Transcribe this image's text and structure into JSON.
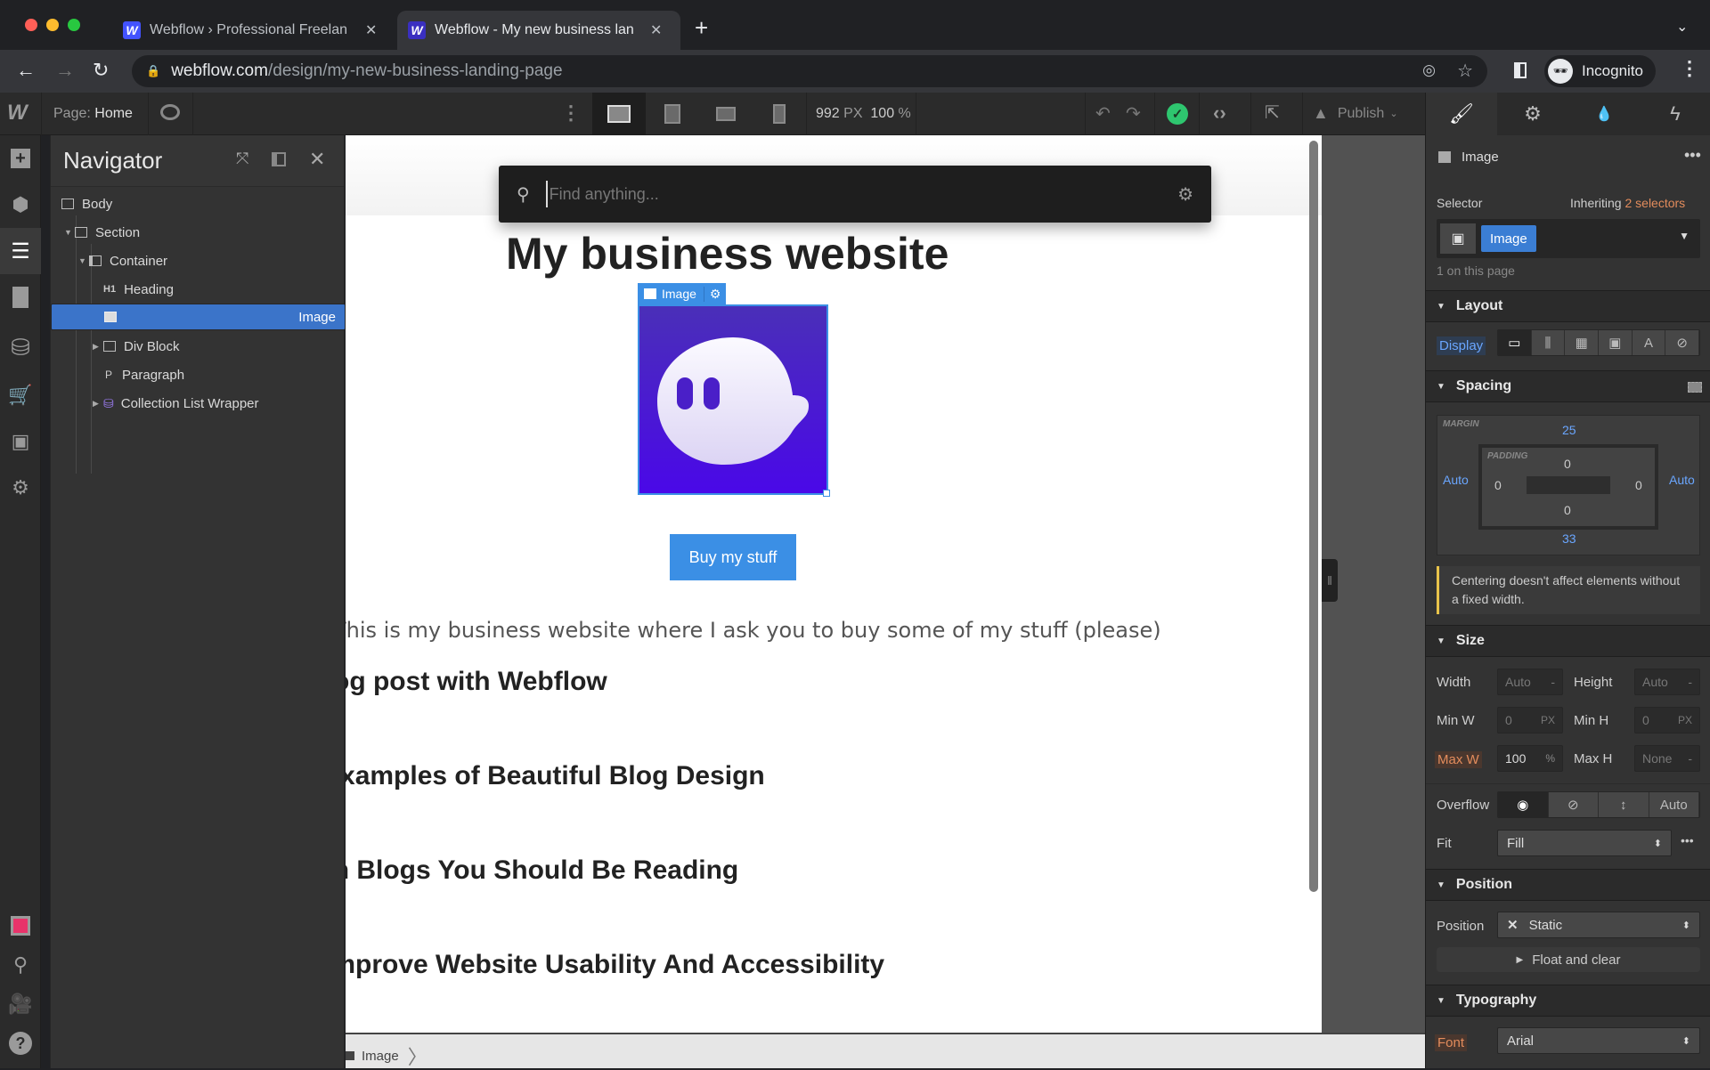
{
  "browser": {
    "tabs": [
      {
        "title": "Webflow › Professional Freelan",
        "favicon": "W",
        "active": false
      },
      {
        "title": "Webflow - My new business lan",
        "favicon": "W",
        "active": true
      }
    ],
    "new_tab_label": "+",
    "url_host": "webflow.com",
    "url_path": "/design/my-new-business-landing-page",
    "profile_label": "Incognito"
  },
  "topbar": {
    "page_label": "Page:",
    "page_name": "Home",
    "canvas_width": "992",
    "canvas_width_unit": "PX",
    "zoom": "100",
    "zoom_unit": "%",
    "publish_label": "Publish",
    "status_color": "#2ec66f"
  },
  "navigator": {
    "title": "Navigator",
    "items": [
      {
        "label": "Body",
        "icon": "body-icon",
        "depth": 0,
        "caret": ""
      },
      {
        "label": "Section",
        "icon": "section-icon",
        "depth": 1,
        "caret": "▼"
      },
      {
        "label": "Container",
        "icon": "container-icon",
        "depth": 2,
        "caret": "▼"
      },
      {
        "label": "Heading",
        "icon": "h1-icon",
        "depth": 3,
        "caret": "",
        "glyph": "H1"
      },
      {
        "label": "Image",
        "icon": "image-icon",
        "depth": 3,
        "caret": "",
        "selected": true
      },
      {
        "label": "Div Block",
        "icon": "div-block-icon",
        "depth": 3,
        "caret": "▶"
      },
      {
        "label": "Paragraph",
        "icon": "paragraph-icon",
        "depth": 3,
        "caret": "",
        "glyph": "P"
      },
      {
        "label": "Collection List Wrapper",
        "icon": "collection-icon",
        "depth": 3,
        "caret": "▶"
      }
    ]
  },
  "search": {
    "placeholder": "Find anything..."
  },
  "canvas": {
    "heading": "My business website",
    "image_badge": "Image",
    "button_label": "Buy my stuff",
    "paragraph": "This is my business website where I ask you to buy some of my stuff (please)",
    "posts": [
      "Blog post with Webflow",
      "Examples of Beautiful Blog Design",
      "Design Blogs You Should Be Reading",
      "Improve Website Usability And Accessibility"
    ],
    "accent_color": "#3b8fe5",
    "image_bg": "#4a18e0"
  },
  "breadcrumb": {
    "items": [
      "Image"
    ]
  },
  "panel": {
    "element_name": "Image",
    "selector_label": "Selector",
    "inheriting_label": "Inheriting",
    "inheriting_count": "2 selectors",
    "selector_tag": "Image",
    "on_page": "1 on this page",
    "layout": {
      "title": "Layout",
      "display_label": "Display"
    },
    "spacing": {
      "title": "Spacing",
      "margin_label": "MARGIN",
      "padding_label": "PADDING",
      "margin_top": "25",
      "margin_bottom": "33",
      "margin_left": "Auto",
      "margin_right": "Auto",
      "padding_top": "0",
      "padding_bottom": "0",
      "padding_left": "0",
      "padding_right": "0",
      "warning": "Centering doesn't affect elements without a fixed width."
    },
    "size": {
      "title": "Size",
      "width_label": "Width",
      "width_value": "Auto",
      "width_unit": "-",
      "height_label": "Height",
      "height_value": "Auto",
      "height_unit": "-",
      "minw_label": "Min W",
      "minw_value": "0",
      "minw_unit": "PX",
      "minh_label": "Min H",
      "minh_value": "0",
      "minh_unit": "PX",
      "maxw_label": "Max W",
      "maxw_value": "100",
      "maxw_unit": "%",
      "maxh_label": "Max H",
      "maxh_value": "None",
      "maxh_unit": "-",
      "overflow_label": "Overflow",
      "overflow_auto": "Auto",
      "fit_label": "Fit",
      "fit_value": "Fill"
    },
    "position": {
      "title": "Position",
      "position_label": "Position",
      "position_value": "Static",
      "float_label": "Float and clear"
    },
    "typography": {
      "title": "Typography",
      "font_label": "Font",
      "font_value": "Arial"
    }
  }
}
